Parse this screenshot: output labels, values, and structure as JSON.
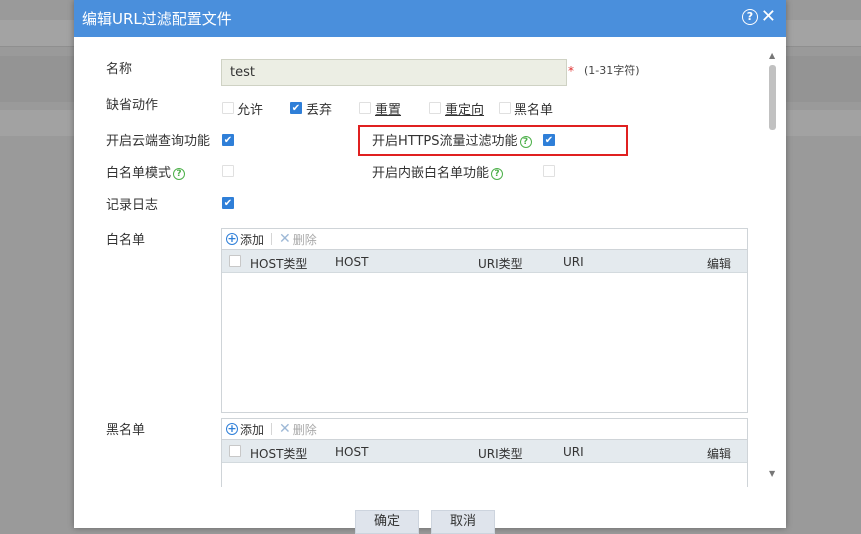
{
  "dialog": {
    "title": "编辑URL过滤配置文件",
    "help_glyph": "?",
    "close_glyph": "✕"
  },
  "form": {
    "name_label": "名称",
    "name_value": "test",
    "required_mark": "*",
    "name_hint": "(1-31字符)",
    "default_action_label": "缺省动作",
    "actions": [
      {
        "label": "允许",
        "checked": false
      },
      {
        "label": "丢弃",
        "checked": true
      },
      {
        "label": "重置",
        "checked": false
      },
      {
        "label": "重定向",
        "checked": false
      },
      {
        "label": "黑名单",
        "checked": false
      }
    ],
    "cloud_query_label": "开启云端查询功能",
    "cloud_query_checked": true,
    "https_filter_label": "开启HTTPS流量过滤功能",
    "https_filter_checked": true,
    "whitelist_mode_label": "白名单模式",
    "whitelist_mode_checked": false,
    "embedded_whitelist_label": "开启内嵌白名单功能",
    "embedded_whitelist_checked": false,
    "log_label": "记录日志",
    "log_checked": true,
    "help_glyph": "?"
  },
  "whitelist": {
    "label": "白名单",
    "add_label": "添加",
    "delete_label": "删除",
    "columns": [
      "HOST类型",
      "HOST",
      "URI类型",
      "URI",
      "编辑"
    ]
  },
  "blacklist": {
    "label": "黑名单",
    "add_label": "添加",
    "delete_label": "删除",
    "columns": [
      "HOST类型",
      "HOST",
      "URI类型",
      "URI",
      "编辑"
    ]
  },
  "footer": {
    "ok_label": "确定",
    "cancel_label": "取消"
  },
  "colors": {
    "titlebar": "#4a8fdc",
    "checkbox_checked": "#2f7fd8",
    "highlight_box": "#e02020",
    "help_icon": "#4db04a"
  }
}
